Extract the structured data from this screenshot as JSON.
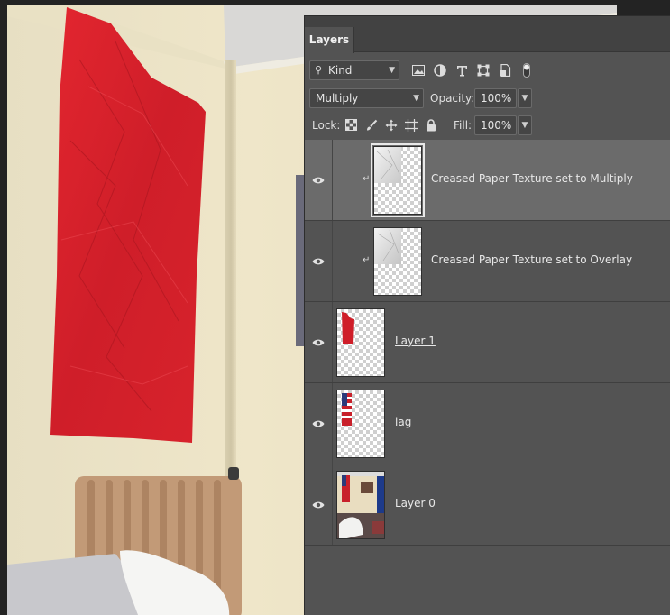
{
  "panel": {
    "tab_label": "Layers",
    "filter": {
      "selected": "Kind",
      "icons": [
        "image-filter-icon",
        "adjustment-filter-icon",
        "type-filter-icon",
        "shape-filter-icon",
        "smart-object-filter-icon",
        "toggle-filter-icon"
      ]
    },
    "blend_mode": "Multiply",
    "opacity_label": "Opacity:",
    "opacity_value": "100%",
    "lock_label": "Lock:",
    "fill_label": "Fill:",
    "fill_value": "100%"
  },
  "layers": [
    {
      "name": "Creased Paper Texture set to Multiply",
      "visible": true,
      "clipped": true,
      "selected": true,
      "thumbnail": "paper-texture"
    },
    {
      "name": "Creased Paper Texture set to Overlay",
      "visible": true,
      "clipped": true,
      "selected": false,
      "thumbnail": "paper-texture"
    },
    {
      "name": "Layer 1",
      "visible": true,
      "clipped": false,
      "selected": false,
      "thumbnail": "red-flag"
    },
    {
      "name": "lag",
      "visible": true,
      "clipped": false,
      "selected": false,
      "thumbnail": "us-flag"
    },
    {
      "name": "Layer 0",
      "visible": true,
      "clipped": false,
      "selected": false,
      "thumbnail": "room-photo"
    }
  ],
  "colors": {
    "panel_bg": "#535353",
    "selected_row": "#6b6b6b",
    "flag_red": "#d4202b",
    "wall": "#ede4c6"
  }
}
